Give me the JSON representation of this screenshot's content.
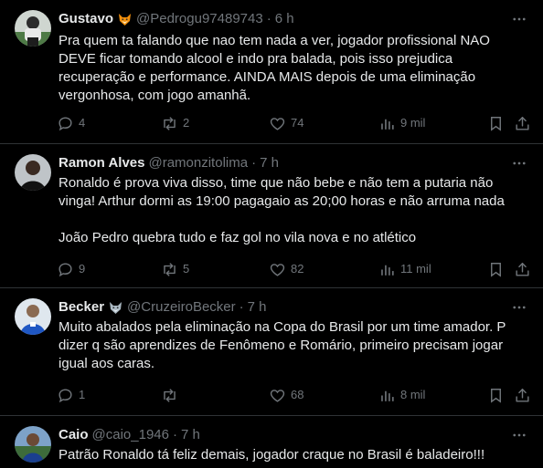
{
  "tweets": [
    {
      "name": "Gustavo",
      "badge_icon": "fox-emoji-icon",
      "handle": "@Pedrogu97489743",
      "separator": "·",
      "time": "6 h",
      "text": "Pra quem ta falando que nao tem nada a ver, jogador profissional NAO DEVE ficar tomando alcool e indo pra balada, pois isso prejudica recuperação e performance. AINDA MAIS depois de uma eliminação vergonhosa, com jogo amanhã.",
      "replies": "4",
      "retweets": "2",
      "likes": "74",
      "views": "9 mil"
    },
    {
      "name": "Ramon Alves",
      "handle": "@ramonzitolima",
      "separator": "·",
      "time": "7 h",
      "text": "Ronaldo é prova viva disso, time que não bebe e não tem a putaria não vinga! Arthur dormi as 19:00 pagagaio as 20;00 horas e não arruma nada\n\nJoão Pedro quebra tudo e faz gol no vila nova e no atlético",
      "replies": "9",
      "retweets": "5",
      "likes": "82",
      "views": "11 mil"
    },
    {
      "name": "Becker",
      "badge_icon": "fox-emoji-icon",
      "handle": "@CruzeiroBecker",
      "separator": "·",
      "time": "7 h",
      "text": "Muito abalados pela eliminação na Copa do Brasil por um time amador. P dizer q são aprendizes de Fenômeno e Romário, primeiro precisam jogar igual aos caras.",
      "replies": "1",
      "retweets": "",
      "likes": "68",
      "views": "8 mil"
    },
    {
      "name": "Caio",
      "handle": "@caio_1946",
      "separator": "·",
      "time": "7 h",
      "text": "Patrão Ronaldo tá feliz demais, jogador craque no Brasil é baladeiro!!!"
    }
  ],
  "colors": {
    "background": "#000000",
    "text": "#e7e9ea",
    "muted": "#71767b",
    "border": "#2f3336"
  },
  "icons": {
    "reply": "reply-icon",
    "retweet": "retweet-icon",
    "like": "heart-icon",
    "views": "views-icon",
    "bookmark": "bookmark-icon",
    "share": "share-icon",
    "more": "more-icon"
  }
}
